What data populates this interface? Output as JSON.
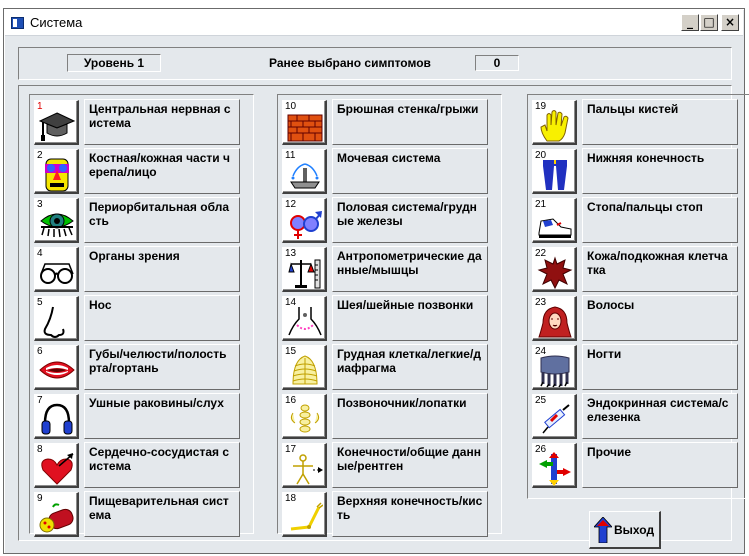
{
  "window": {
    "title": "Система",
    "minimize": "_",
    "maximize": "□",
    "close": "×"
  },
  "status": {
    "level": "Уровень 1",
    "previous_label": "Ранее выбрано симптомов",
    "previous_count": "0"
  },
  "columns": [
    [
      {
        "num": "1",
        "label": "Центральная нервная система",
        "icon": "graduation-cap-icon"
      },
      {
        "num": "2",
        "label": "Костная/кожная части черепа/лицо",
        "icon": "face-icon"
      },
      {
        "num": "3",
        "label": "Периорбитальная область",
        "icon": "eye-icon"
      },
      {
        "num": "4",
        "label": "Органы зрения",
        "icon": "glasses-icon"
      },
      {
        "num": "5",
        "label": "Нос",
        "icon": "nose-icon"
      },
      {
        "num": "6",
        "label": "Губы/челюсти/полость рта/гортань",
        "icon": "mouth-icon"
      },
      {
        "num": "7",
        "label": "Ушные раковины/слух",
        "icon": "headphones-icon"
      },
      {
        "num": "8",
        "label": "Сердечно-сосудистая система",
        "icon": "heart-icon"
      },
      {
        "num": "9",
        "label": "Пищеварительная система",
        "icon": "food-icon"
      }
    ],
    [
      {
        "num": "10",
        "label": "Брюшная стенка/грыжи",
        "icon": "brick-wall-icon"
      },
      {
        "num": "11",
        "label": "Мочевая система",
        "icon": "fountain-icon"
      },
      {
        "num": "12",
        "label": "Половая система/грудные железы",
        "icon": "gender-icon"
      },
      {
        "num": "13",
        "label": "Антропометрические данные/мышцы",
        "icon": "scales-icon"
      },
      {
        "num": "14",
        "label": "Шея/шейные позвонки",
        "icon": "neck-icon"
      },
      {
        "num": "15",
        "label": "Грудная клетка/легкие/диафрагма",
        "icon": "chest-icon"
      },
      {
        "num": "16",
        "label": "Позвоночник/лопатки",
        "icon": "spine-icon"
      },
      {
        "num": "17",
        "label": "Конечности/общие данные/рентген",
        "icon": "xray-icon"
      },
      {
        "num": "18",
        "label": "Верхняя конечность/кисть",
        "icon": "arm-icon"
      }
    ],
    [
      {
        "num": "19",
        "label": "Пальцы кистей",
        "icon": "hand-icon"
      },
      {
        "num": "20",
        "label": "Нижняя конечность",
        "icon": "legs-icon"
      },
      {
        "num": "21",
        "label": "Стопа/пальцы стоп",
        "icon": "shoe-icon"
      },
      {
        "num": "22",
        "label": "Кожа/подкожная клетчатка",
        "icon": "skin-icon"
      },
      {
        "num": "23",
        "label": "Волосы",
        "icon": "hair-icon"
      },
      {
        "num": "24",
        "label": "Ногти",
        "icon": "nails-icon"
      },
      {
        "num": "25",
        "label": "Эндокринная система/селезенка",
        "icon": "syringe-icon"
      },
      {
        "num": "26",
        "label": "Прочие",
        "icon": "arrows-icon"
      }
    ]
  ],
  "exit_label": "Выход",
  "colors": {
    "background": "#e4e8ec",
    "first_number": "#e00000",
    "accent": "#1e4fb5"
  }
}
